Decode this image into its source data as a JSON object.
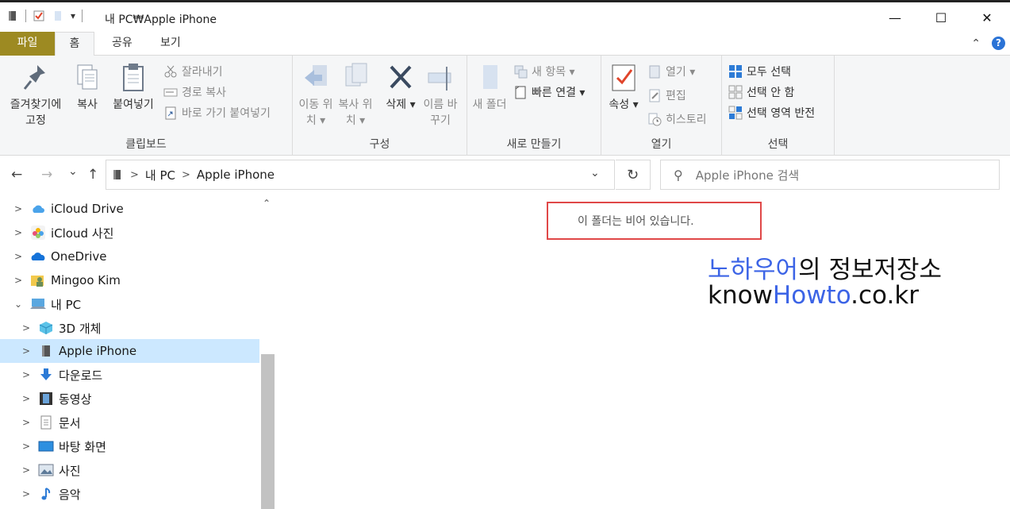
{
  "window": {
    "title": "내 PC₩Apple iPhone",
    "minimize_glyph": "—",
    "maximize_glyph": "☐",
    "close_glyph": "✕",
    "qat_dropdown_glyph": "▾"
  },
  "ribbon_tabs": {
    "file": "파일",
    "home": "홈",
    "share": "공유",
    "view": "보기",
    "expand_glyph": "⌃",
    "help_glyph": "?"
  },
  "clipboard": {
    "pin_label": "즐겨찾기에 고정",
    "copy_label": "복사",
    "paste_label": "붙여넣기",
    "cut_label": "잘라내기",
    "copy_path_label": "경로 복사",
    "paste_shortcut_label": "바로 가기 붙여넣기",
    "group_label": "클립보드"
  },
  "organize": {
    "move_label": "이동 위치 ▾",
    "copyto_label": "복사 위치 ▾",
    "delete_label": "삭제 ▾",
    "rename_label": "이름 바꾸기",
    "group_label": "구성"
  },
  "new_group": {
    "new_folder_label": "새 폴더",
    "new_item_label": "새 항목 ▾",
    "easy_access_label": "빠른 연결 ▾",
    "group_label": "새로 만들기"
  },
  "open_group": {
    "properties_label": "속성 ▾",
    "open_label": "열기 ▾",
    "edit_label": "편집",
    "history_label": "히스토리",
    "group_label": "열기"
  },
  "select_group": {
    "select_all_label": "모두 선택",
    "select_none_label": "선택 안 함",
    "invert_label": "선택 영역 반전",
    "group_label": "선택"
  },
  "nav": {
    "back_glyph": "←",
    "forward_glyph": "→",
    "recent_glyph": "⌄",
    "up_glyph": "↑",
    "breadcrumbs": [
      "내 PC",
      "Apple iPhone"
    ],
    "crumb_sep": ">",
    "dropdown_glyph": "⌄",
    "refresh_glyph": "↻",
    "search_placeholder": "Apple iPhone 검색",
    "search_glyph": "⚲"
  },
  "tree": {
    "items": [
      {
        "label": "iCloud Drive",
        "chevron": ">"
      },
      {
        "label": "iCloud 사진",
        "chevron": ">"
      },
      {
        "label": "OneDrive",
        "chevron": ">"
      },
      {
        "label": "Mingoo Kim",
        "chevron": ">"
      },
      {
        "label": "내 PC",
        "chevron": "⌄"
      },
      {
        "label": "3D 개체",
        "chevron": ">"
      },
      {
        "label": "Apple iPhone",
        "chevron": ">"
      },
      {
        "label": "다운로드",
        "chevron": ">"
      },
      {
        "label": "동영상",
        "chevron": ">"
      },
      {
        "label": "문서",
        "chevron": ">"
      },
      {
        "label": "바탕 화면",
        "chevron": ">"
      },
      {
        "label": "사진",
        "chevron": ">"
      },
      {
        "label": "음악",
        "chevron": ">"
      }
    ],
    "scroll_up_glyph": "⌃"
  },
  "content": {
    "empty_message": "이 폴더는 비어 있습니다."
  },
  "watermark": {
    "line1_blue": "노하우어",
    "line1_rest": "의 정보저장소",
    "line2_a": "know",
    "line2_blue": "Howto",
    "line2_b": ".co.kr"
  },
  "colors": {
    "file_tab": "#9d8a22",
    "selection": "#cce8ff",
    "highlight_box": "#e04848",
    "watermark_blue": "#3c64e6"
  }
}
